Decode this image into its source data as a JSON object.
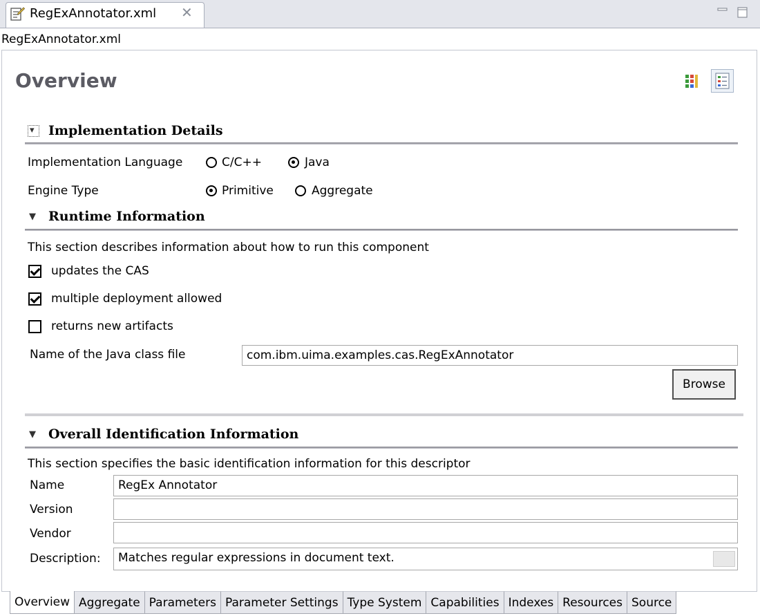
{
  "editor_tab": {
    "title": "RegExAnnotator.xml",
    "icon": "xml-editor-icon",
    "close_glyph": "✕"
  },
  "path_label": "RegExAnnotator.xml",
  "page_title": "Overview",
  "view_icons": [
    "grid-view-icon",
    "list-view-icon"
  ],
  "implementation": {
    "title": "Implementation Details",
    "language_label": "Implementation Language",
    "language_options": [
      "C/C++",
      "Java"
    ],
    "language_selected": "Java",
    "engine_label": "Engine Type",
    "engine_options": [
      "Primitive",
      "Aggregate"
    ],
    "engine_selected": "Primitive"
  },
  "runtime": {
    "title": "Runtime Information",
    "description": "This section describes information about how to run this component",
    "checkboxes": [
      {
        "label": "updates the CAS",
        "checked": true
      },
      {
        "label": "multiple deployment allowed",
        "checked": true
      },
      {
        "label": "returns new artifacts",
        "checked": false
      }
    ],
    "class_file_label": "Name of the Java class file",
    "class_file_value": "com.ibm.uima.examples.cas.RegExAnnotator",
    "browse_label": "Browse"
  },
  "identification": {
    "title": "Overall Identification Information",
    "description": "This section specifies the basic identification information for this descriptor",
    "fields": [
      {
        "label": "Name",
        "value": "RegEx Annotator"
      },
      {
        "label": "Version",
        "value": ""
      },
      {
        "label": "Vendor",
        "value": ""
      },
      {
        "label": "Description:",
        "value": "Matches regular expressions in document text."
      }
    ]
  },
  "bottom_tabs": [
    "Overview",
    "Aggregate",
    "Parameters",
    "Parameter Settings",
    "Type System",
    "Capabilities",
    "Indexes",
    "Resources",
    "Source"
  ],
  "active_bottom_tab": "Overview",
  "colors": {
    "title_gray": "#5b5b63",
    "tab_strip_bg": "#e4e6ec"
  }
}
